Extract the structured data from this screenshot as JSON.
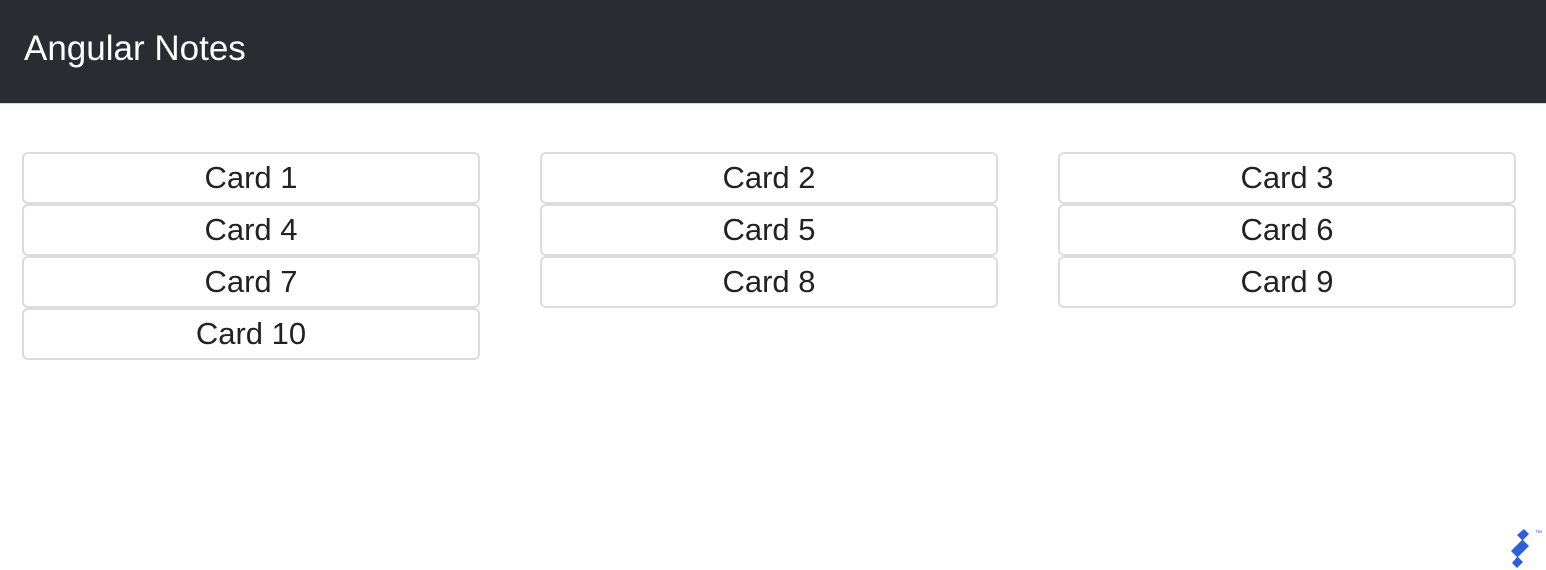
{
  "navbar": {
    "brand": "Angular Notes"
  },
  "cards": [
    {
      "label": "Card 1"
    },
    {
      "label": "Card 2"
    },
    {
      "label": "Card 3"
    },
    {
      "label": "Card 4"
    },
    {
      "label": "Card 5"
    },
    {
      "label": "Card 6"
    },
    {
      "label": "Card 7"
    },
    {
      "label": "Card 8"
    },
    {
      "label": "Card 9"
    },
    {
      "label": "Card 10"
    }
  ],
  "logo": {
    "icon": "toptal-logo-icon",
    "color": "#2f5fd6"
  },
  "colors": {
    "navbar_bg": "#292d32",
    "card_border": "#dcdcdc",
    "text": "#222222"
  }
}
